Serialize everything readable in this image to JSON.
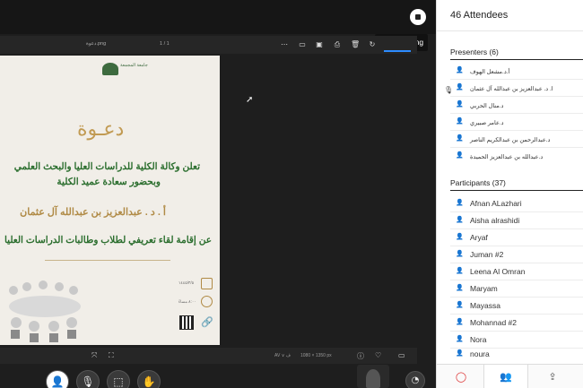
{
  "header": {
    "stop_sharing_label": "Stop Sharing"
  },
  "viewer": {
    "doc_name": "دعوة.png",
    "page_indicator": "1 / 1",
    "zoom": "AV ∨ ف",
    "size": "1080 × 1350 px"
  },
  "slide": {
    "title_word": "دعـوة",
    "line1": "تعلن وكالة الكلية للدراسات العليا والبحث العلمي",
    "line2": "وبحضور سعادة عميد الكلية",
    "line3": "أ . د . عبدالعزيز بن عبدالله آل عثمان",
    "line4": "عن إقامة لقاء تعريفي لطلاب وطالبات الدراسات العليا",
    "logo_text": "جامعة المجمعة",
    "date_text": "١٤٤٥/٣/٥",
    "time_text": "٨:٠٠ مساءً"
  },
  "panel": {
    "attendees_title": "46 Attendees",
    "presenters_title": "Presenters (6)",
    "presenters": [
      "أ.د.مشعل الهوف",
      "ا. د. عبدالعزيز بن عبدالله آل عثمان",
      "د.منال الحربي",
      "د.عامر صبيري",
      "د.عبدالرحمن بن عبدالكريم الناصر",
      "د.عبدالله بن عبدالعزيز الحميدة"
    ],
    "participants_title": "Participants (37)",
    "participants": [
      "Afnan ALazhari",
      "Aisha alrashidi",
      "Aryaf",
      "Juman #2",
      "Leena Al Omran",
      "Maryam",
      "Mayassa",
      "Mohannad #2",
      "Nora",
      "noura"
    ]
  },
  "icons": {
    "person": "👤",
    "mic": "🎙"
  }
}
